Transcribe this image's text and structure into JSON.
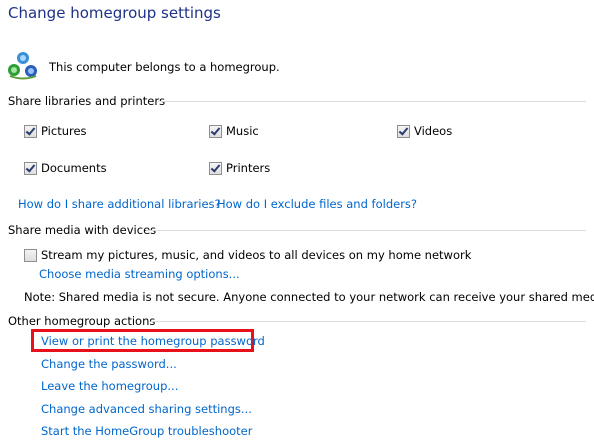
{
  "page": {
    "title": "Change homegroup settings",
    "status_text": "This computer belongs to a homegroup."
  },
  "libraries": {
    "heading": "Share libraries and printers",
    "items": [
      {
        "label": "Pictures",
        "checked": true
      },
      {
        "label": "Music",
        "checked": true
      },
      {
        "label": "Videos",
        "checked": true
      },
      {
        "label": "Documents",
        "checked": true
      },
      {
        "label": "Printers",
        "checked": true
      }
    ],
    "link_additional": "How do I share additional libraries?",
    "link_exclude": "How do I exclude files and folders?"
  },
  "media": {
    "heading": "Share media with devices",
    "stream_label": "Stream my pictures, music, and videos to all devices on my home network",
    "stream_checked": false,
    "streaming_options_link": "Choose media streaming options...",
    "note": "Note: Shared media is not secure. Anyone connected to your network can receive your shared media."
  },
  "other": {
    "heading": "Other homegroup actions",
    "actions": [
      "View or print the homegroup password",
      "Change the password...",
      "Leave the homegroup...",
      "Change advanced sharing settings...",
      "Start the HomeGroup troubleshooter"
    ]
  },
  "colors": {
    "title": "#1e3287",
    "link": "#0066cc",
    "highlight": "#e8101a"
  }
}
